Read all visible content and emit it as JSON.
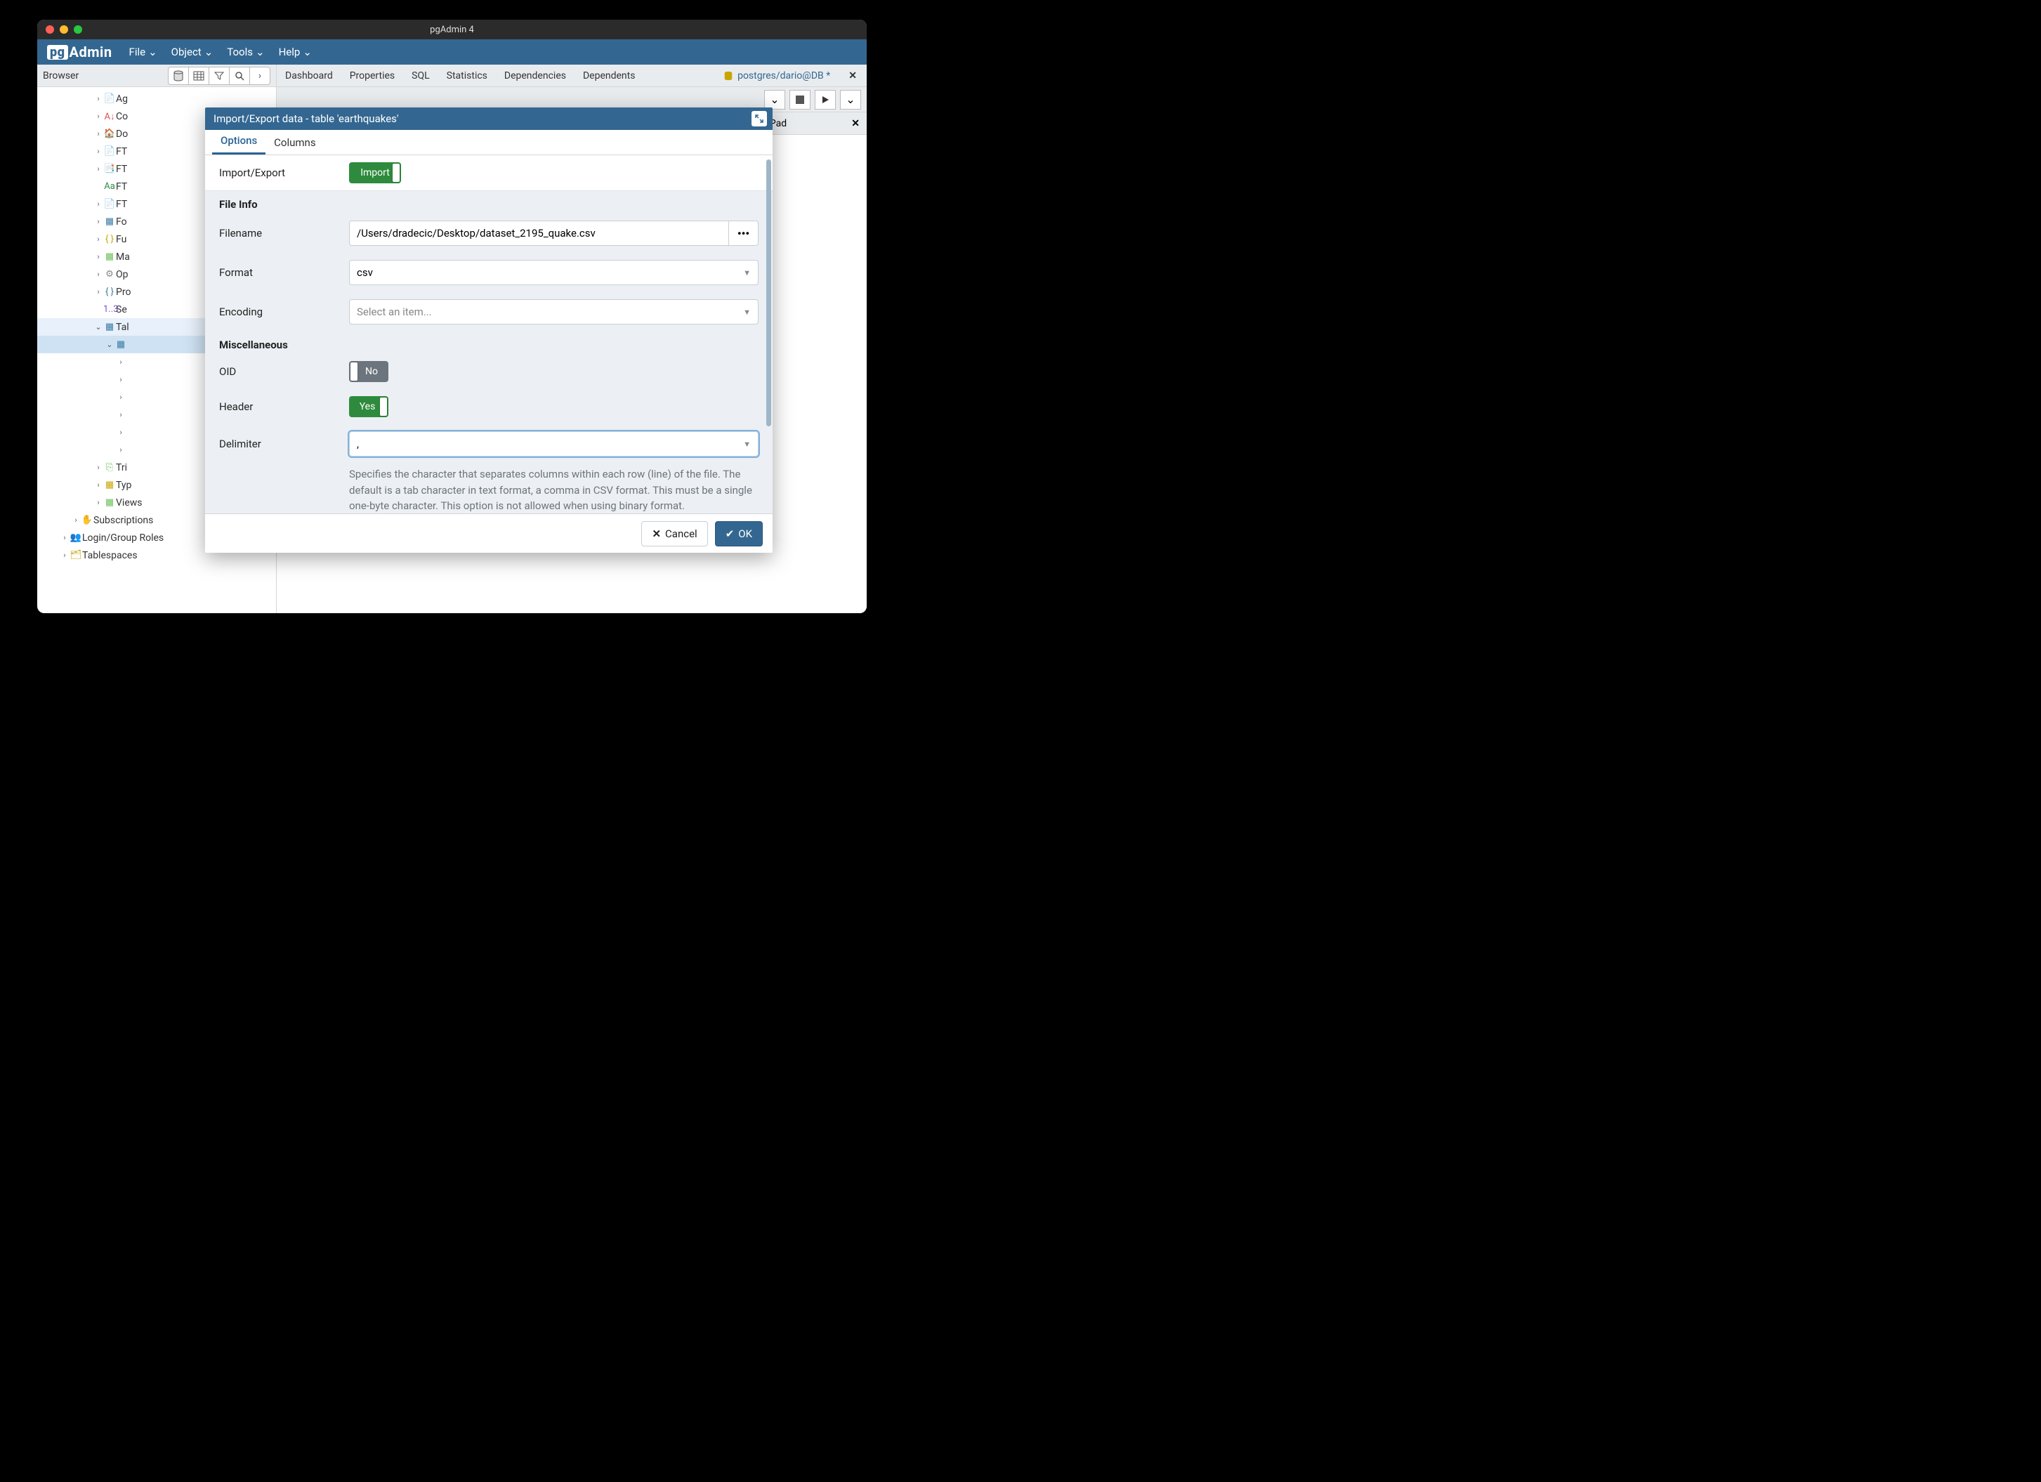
{
  "window": {
    "title": "pgAdmin 4"
  },
  "menubar": {
    "logo_pg": "pg",
    "logo_admin": "Admin",
    "items": [
      "File",
      "Object",
      "Tools",
      "Help"
    ]
  },
  "browser": {
    "title": "Browser",
    "tree": [
      {
        "indent": 5,
        "caret": "›",
        "icon": "📄",
        "color": "#8a8a8a",
        "label": "Ag"
      },
      {
        "indent": 5,
        "caret": "›",
        "icon": "A↓",
        "color": "#d9534f",
        "label": "Co"
      },
      {
        "indent": 5,
        "caret": "›",
        "icon": "🏠",
        "color": "#8a8a8a",
        "label": "Do"
      },
      {
        "indent": 5,
        "caret": "›",
        "icon": "📄",
        "color": "#8a8a8a",
        "label": "FT"
      },
      {
        "indent": 5,
        "caret": "›",
        "icon": "📑",
        "color": "#8a8a8a",
        "label": "FT"
      },
      {
        "indent": 5,
        "caret": "",
        "icon": "Aa",
        "color": "#2e8b3d",
        "label": "FT"
      },
      {
        "indent": 5,
        "caret": "›",
        "icon": "📄",
        "color": "#c9a500",
        "label": "FT"
      },
      {
        "indent": 5,
        "caret": "›",
        "icon": "▦",
        "color": "#3a7ca5",
        "label": "Fo"
      },
      {
        "indent": 5,
        "caret": "›",
        "icon": "{ }",
        "color": "#c9a500",
        "label": "Fu"
      },
      {
        "indent": 5,
        "caret": "›",
        "icon": "▦",
        "color": "#6bbf59",
        "label": "Ma"
      },
      {
        "indent": 5,
        "caret": "›",
        "icon": "⚙",
        "color": "#8a8a8a",
        "label": "Op"
      },
      {
        "indent": 5,
        "caret": "›",
        "icon": "{ }",
        "color": "#3a7ca5",
        "label": "Pro"
      },
      {
        "indent": 5,
        "caret": "",
        "icon": "1..3",
        "color": "#7b4fd1",
        "label": "Se"
      },
      {
        "indent": 5,
        "caret": "⌄",
        "icon": "▦",
        "color": "#3a7ca5",
        "label": "Tal",
        "selband": true
      },
      {
        "indent": 6,
        "caret": "⌄",
        "icon": "▦",
        "color": "#3a7ca5",
        "label": "",
        "sel": true
      },
      {
        "indent": 7,
        "caret": "›",
        "icon": "",
        "color": "",
        "label": ""
      },
      {
        "indent": 7,
        "caret": "›",
        "icon": "",
        "color": "",
        "label": ""
      },
      {
        "indent": 7,
        "caret": "›",
        "icon": "",
        "color": "",
        "label": ""
      },
      {
        "indent": 7,
        "caret": "›",
        "icon": "",
        "color": "",
        "label": ""
      },
      {
        "indent": 7,
        "caret": "›",
        "icon": "",
        "color": "",
        "label": ""
      },
      {
        "indent": 7,
        "caret": "›",
        "icon": "",
        "color": "",
        "label": ""
      },
      {
        "indent": 5,
        "caret": "›",
        "icon": "⎘",
        "color": "#6bbf59",
        "label": "Tri"
      },
      {
        "indent": 5,
        "caret": "›",
        "icon": "▦",
        "color": "#c9a500",
        "label": "Typ"
      },
      {
        "indent": 5,
        "caret": "›",
        "icon": "▦",
        "color": "#6bbf59",
        "label": "Views"
      },
      {
        "indent": 3,
        "caret": "›",
        "icon": "✋",
        "color": "#e59b42",
        "label": "Subscriptions"
      },
      {
        "indent": 2,
        "caret": "›",
        "icon": "👥",
        "color": "#3a7ca5",
        "label": "Login/Group Roles"
      },
      {
        "indent": 2,
        "caret": "›",
        "icon": "🗂",
        "color": "#c9a500",
        "label": "Tablespaces"
      }
    ]
  },
  "right": {
    "tabs": [
      "Dashboard",
      "Properties",
      "SQL",
      "Statistics",
      "Dependencies",
      "Dependents"
    ],
    "db_tab": "postgres/dario@DB *",
    "scratch": "Scratch Pad"
  },
  "modal": {
    "title": "Import/Export data - table 'earthquakes'",
    "tabs": {
      "options": "Options",
      "columns": "Columns"
    },
    "fields": {
      "import_export_label": "Import/Export",
      "import_export_value": "Import",
      "file_info": "File Info",
      "filename_label": "Filename",
      "filename_value": "/Users/dradecic/Desktop/dataset_2195_quake.csv",
      "format_label": "Format",
      "format_value": "csv",
      "encoding_label": "Encoding",
      "encoding_placeholder": "Select an item...",
      "misc": "Miscellaneous",
      "oid_label": "OID",
      "oid_value": "No",
      "header_label": "Header",
      "header_value": "Yes",
      "delimiter_label": "Delimiter",
      "delimiter_value": ",",
      "delimiter_help": "Specifies the character that separates columns within each row (line) of the file. The default is a tab character in text format, a comma in CSV format. This must be a single one-byte character. This option is not allowed when using binary format."
    },
    "footer": {
      "cancel": "Cancel",
      "ok": "OK"
    }
  }
}
